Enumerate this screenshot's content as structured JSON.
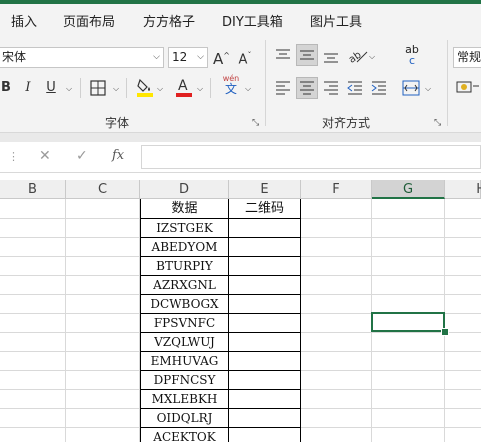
{
  "tabs": [
    "插入",
    "页面布局",
    "方方格子",
    "DIY工具箱",
    "图片工具"
  ],
  "font": {
    "name": "宋体",
    "size": "12",
    "group_label": "字体",
    "bold": "B",
    "italic": "I",
    "underline": "U",
    "phonetic_top": "wén",
    "phonetic_bottom": "文",
    "grow": "A",
    "shrink": "A"
  },
  "alignment": {
    "group_label": "对齐方式",
    "wrap_top": "ab",
    "wrap_bottom": "c"
  },
  "number": {
    "format": "常规"
  },
  "formula_bar": {
    "fx": "fx",
    "cancel": "✕",
    "confirm": "✓",
    "value": ""
  },
  "columns": [
    "B",
    "C",
    "D",
    "E",
    "F",
    "G",
    "H"
  ],
  "selected_column": "G",
  "table": {
    "headers": [
      "数据",
      "二维码"
    ],
    "rows": [
      "IZSTGEK",
      "ABEDYOM",
      "BTURPIY",
      "AZRXGNL",
      "DCWBOGX",
      "FPSVNFC",
      "VZQLWUJ",
      "EMHUVAG",
      "DPFNCSY",
      "MXLEBKH",
      "OIDQLRJ",
      "ACEKTOK"
    ]
  },
  "colors": {
    "accent": "#217346",
    "font_color": "#e02020",
    "highlight": "#ffe600"
  }
}
